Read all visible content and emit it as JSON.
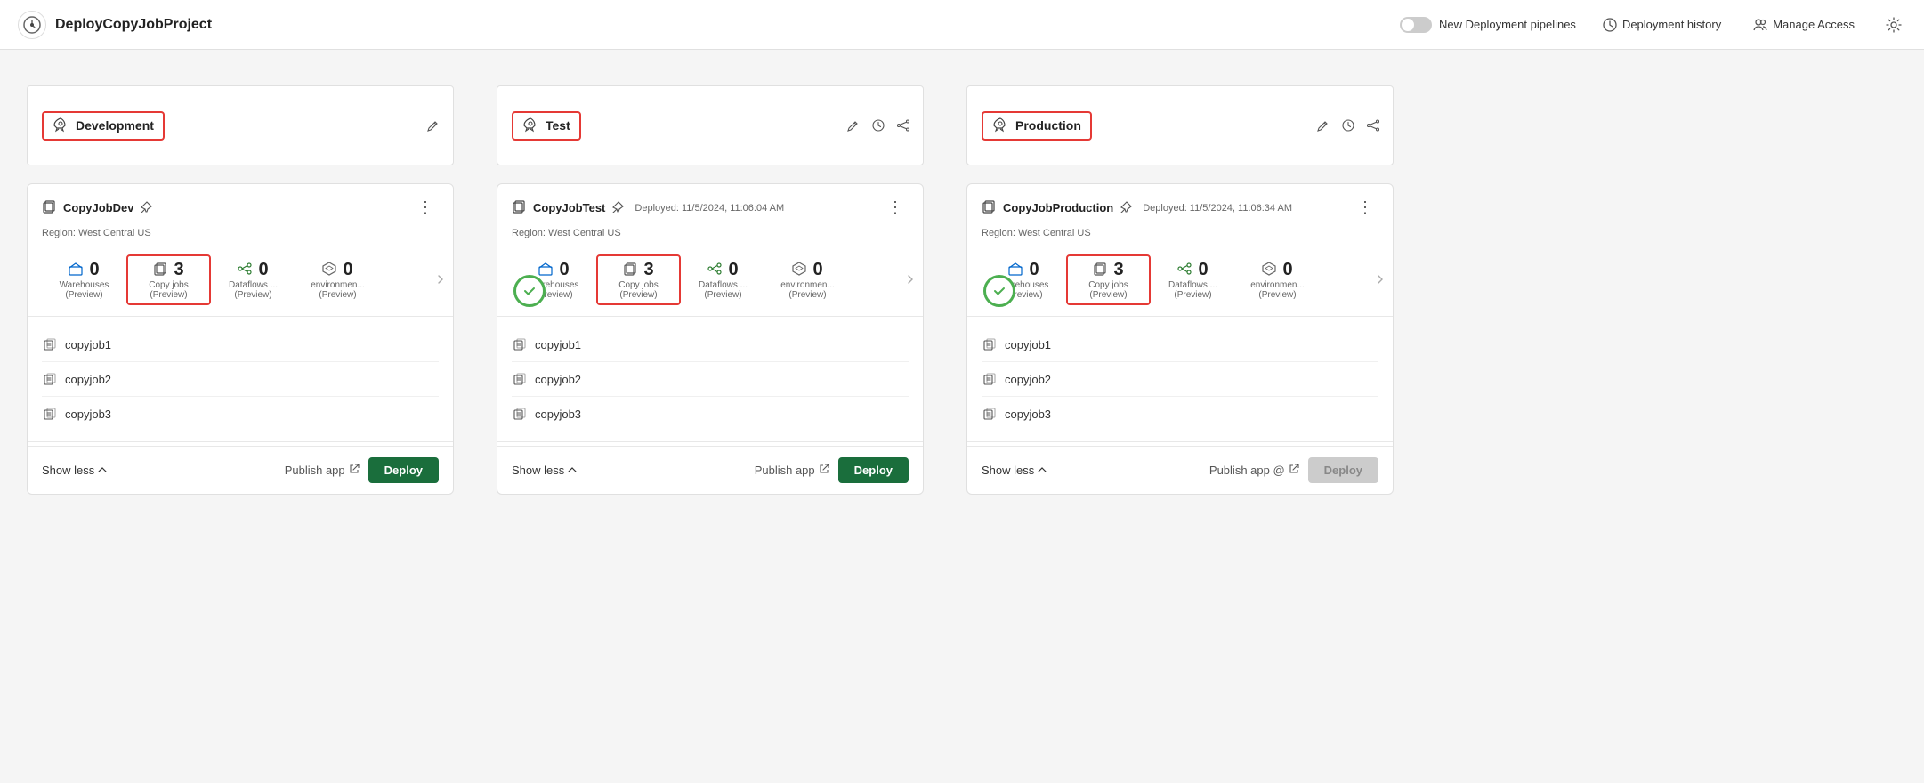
{
  "header": {
    "app_name": "DeployCopyJobProject",
    "toggle_label": "New Deployment pipelines",
    "history_label": "Deployment history",
    "manage_access_label": "Manage Access"
  },
  "stages": [
    {
      "id": "dev",
      "label": "Development",
      "show_edit": true,
      "show_history": false,
      "show_share": false,
      "pipeline": {
        "name": "CopyJobDev",
        "show_pin": true,
        "deployed": null,
        "region": "Region: West Central US",
        "metrics": [
          {
            "icon": "warehouse",
            "count": "0",
            "label": "Warehouses\n(Preview)",
            "highlighted": false
          },
          {
            "icon": "copy",
            "count": "3",
            "label": "Copy jobs\n(Preview)",
            "highlighted": true
          },
          {
            "icon": "dataflow",
            "count": "0",
            "label": "Dataflows ...\n(Preview)",
            "highlighted": false
          },
          {
            "icon": "env",
            "count": "0",
            "label": "environmen...\n(Preview)",
            "highlighted": false
          }
        ],
        "show_success": false,
        "items": [
          "copyjob1",
          "copyjob2",
          "copyjob3"
        ],
        "publish_label": "Publish app",
        "deploy_label": "Deploy",
        "deploy_disabled": false,
        "show_less_label": "Show less"
      }
    },
    {
      "id": "test",
      "label": "Test",
      "show_edit": true,
      "show_history": true,
      "show_share": true,
      "pipeline": {
        "name": "CopyJobTest",
        "show_pin": true,
        "deployed": "Deployed: 11/5/2024, 11:06:04 AM",
        "region": "Region: West Central US",
        "metrics": [
          {
            "icon": "warehouse",
            "count": "0",
            "label": "Warehouses\n(Preview)",
            "highlighted": false
          },
          {
            "icon": "copy",
            "count": "3",
            "label": "Copy jobs\n(Preview)",
            "highlighted": true
          },
          {
            "icon": "dataflow",
            "count": "0",
            "label": "Dataflows ...\n(Preview)",
            "highlighted": false
          },
          {
            "icon": "env",
            "count": "0",
            "label": "environmen...\n(Preview)",
            "highlighted": false
          }
        ],
        "show_success": true,
        "items": [
          "copyjob1",
          "copyjob2",
          "copyjob3"
        ],
        "publish_label": "Publish app",
        "deploy_label": "Deploy",
        "deploy_disabled": false,
        "show_less_label": "Show less"
      }
    },
    {
      "id": "production",
      "label": "Production",
      "show_edit": true,
      "show_history": true,
      "show_share": true,
      "pipeline": {
        "name": "CopyJobProduction",
        "show_pin": true,
        "deployed": "Deployed: 11/5/2024, 11:06:34 AM",
        "region": "Region: West Central US",
        "metrics": [
          {
            "icon": "warehouse",
            "count": "0",
            "label": "Warehouses\n(Preview)",
            "highlighted": false
          },
          {
            "icon": "copy",
            "count": "3",
            "label": "Copy jobs\n(Preview)",
            "highlighted": true
          },
          {
            "icon": "dataflow",
            "count": "0",
            "label": "Dataflows ...\n(Preview)",
            "highlighted": false
          },
          {
            "icon": "env",
            "count": "0",
            "label": "environmen...\n(Preview)",
            "highlighted": false
          }
        ],
        "show_success": true,
        "items": [
          "copyjob1",
          "copyjob2",
          "copyjob3"
        ],
        "publish_label": "Publish app @",
        "deploy_label": "Deploy",
        "deploy_disabled": true,
        "show_less_label": "Show less"
      }
    }
  ]
}
